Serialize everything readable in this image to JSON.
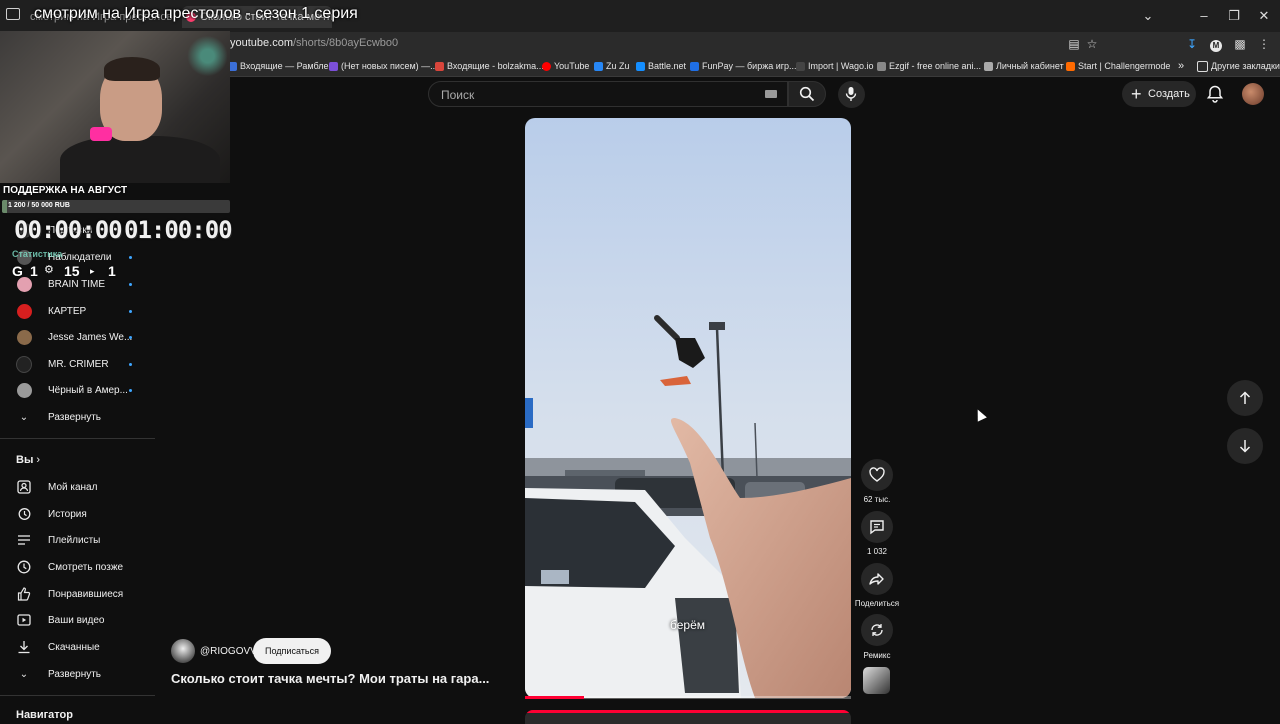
{
  "browser": {
    "tabs": [
      {
        "label": "смотрим на Игра престолов"
      },
      {
        "label": "Сколько стоит тачка мечты?"
      }
    ],
    "overlay_title": "смотрим на Игра престолов - сезон 1 серия",
    "url_prefix": "",
    "url_domain": "youtube.com",
    "url_path": "/shorts/8b0ayEcwbo0",
    "bookmarks": [
      {
        "label": "Входящие — Рамбле...",
        "color": "#3b6fd8"
      },
      {
        "label": "(Нет новых писем) —...",
        "color": "#7b4fd8"
      },
      {
        "label": "Входящие - bolzakma...",
        "color": "#d8453b"
      },
      {
        "label": "YouTube",
        "color": "#ff0000"
      },
      {
        "label": "Zu Zu",
        "color": "#2787f5"
      },
      {
        "label": "Battle.net",
        "color": "#148eff"
      },
      {
        "label": "FunPay — биржа игр...",
        "color": "#1f6fe6"
      },
      {
        "label": "Import | Wago.io",
        "color": "#444444"
      },
      {
        "label": "Ezgif - free online ani...",
        "color": "#888888"
      },
      {
        "label": "Личный кабинет",
        "color": "#aaaaaa"
      },
      {
        "label": "Start | Challengermode",
        "color": "#ff6a00"
      }
    ],
    "other_bookmarks": "Другие закладки"
  },
  "header": {
    "search_placeholder": "Поиск",
    "create_label": "Создать"
  },
  "stream_overlay": {
    "support_title": "ПОДДЕРЖКА НА АВГУСТ",
    "support_amount": "1 200 / 50 000 RUB",
    "support_progress": 0.024,
    "timer_elapsed": "00:00:00",
    "timer_total": "01:00:00",
    "stats_label": "Статистика",
    "stats": [
      "1",
      "15",
      "1"
    ]
  },
  "sidebar": {
    "channels": [
      {
        "label": "Подписки",
        "color": "#3a3a3a"
      },
      {
        "label": "Наблюдатели",
        "color": "#555555"
      },
      {
        "label": "BRAIN TIME",
        "color": "#e3a0b0"
      },
      {
        "label": "КАРТЕР",
        "color": "#d61f1f"
      },
      {
        "label": "Jesse James We...",
        "color": "#8a6a4a"
      },
      {
        "label": "MR. CRIMER",
        "color": "#222222"
      },
      {
        "label": "Чёрный в Амер...",
        "color": "#9a9a9a"
      }
    ],
    "expand_1": "Развернуть",
    "you_section": "Вы",
    "you_items": [
      {
        "label": "Мой канал",
        "icon": "person-icon"
      },
      {
        "label": "История",
        "icon": "history-icon"
      },
      {
        "label": "Плейлисты",
        "icon": "playlist-icon"
      },
      {
        "label": "Смотреть позже",
        "icon": "clock-icon"
      },
      {
        "label": "Понравившиеся",
        "icon": "thumb-up-icon"
      },
      {
        "label": "Ваши видео",
        "icon": "play-box-icon"
      },
      {
        "label": "Скачанные",
        "icon": "download-icon"
      }
    ],
    "expand_2": "Развернуть",
    "navigator_section": "Навигатор"
  },
  "short": {
    "caption": "берём",
    "progress": 0.18,
    "channel_name": "@RIOGOVV",
    "subscribe_label": "Подписаться",
    "title": "Сколько стоит тачка мечты? Мои траты на гара...",
    "actions": {
      "like_count": "62 тыс.",
      "comment_count": "1 032",
      "share_label": "Поделиться",
      "remix_label": "Ремикс"
    }
  },
  "colors": {
    "background": "#0f0f0f",
    "accent_red": "#ff0033",
    "link_blue": "#3ea6ff"
  }
}
